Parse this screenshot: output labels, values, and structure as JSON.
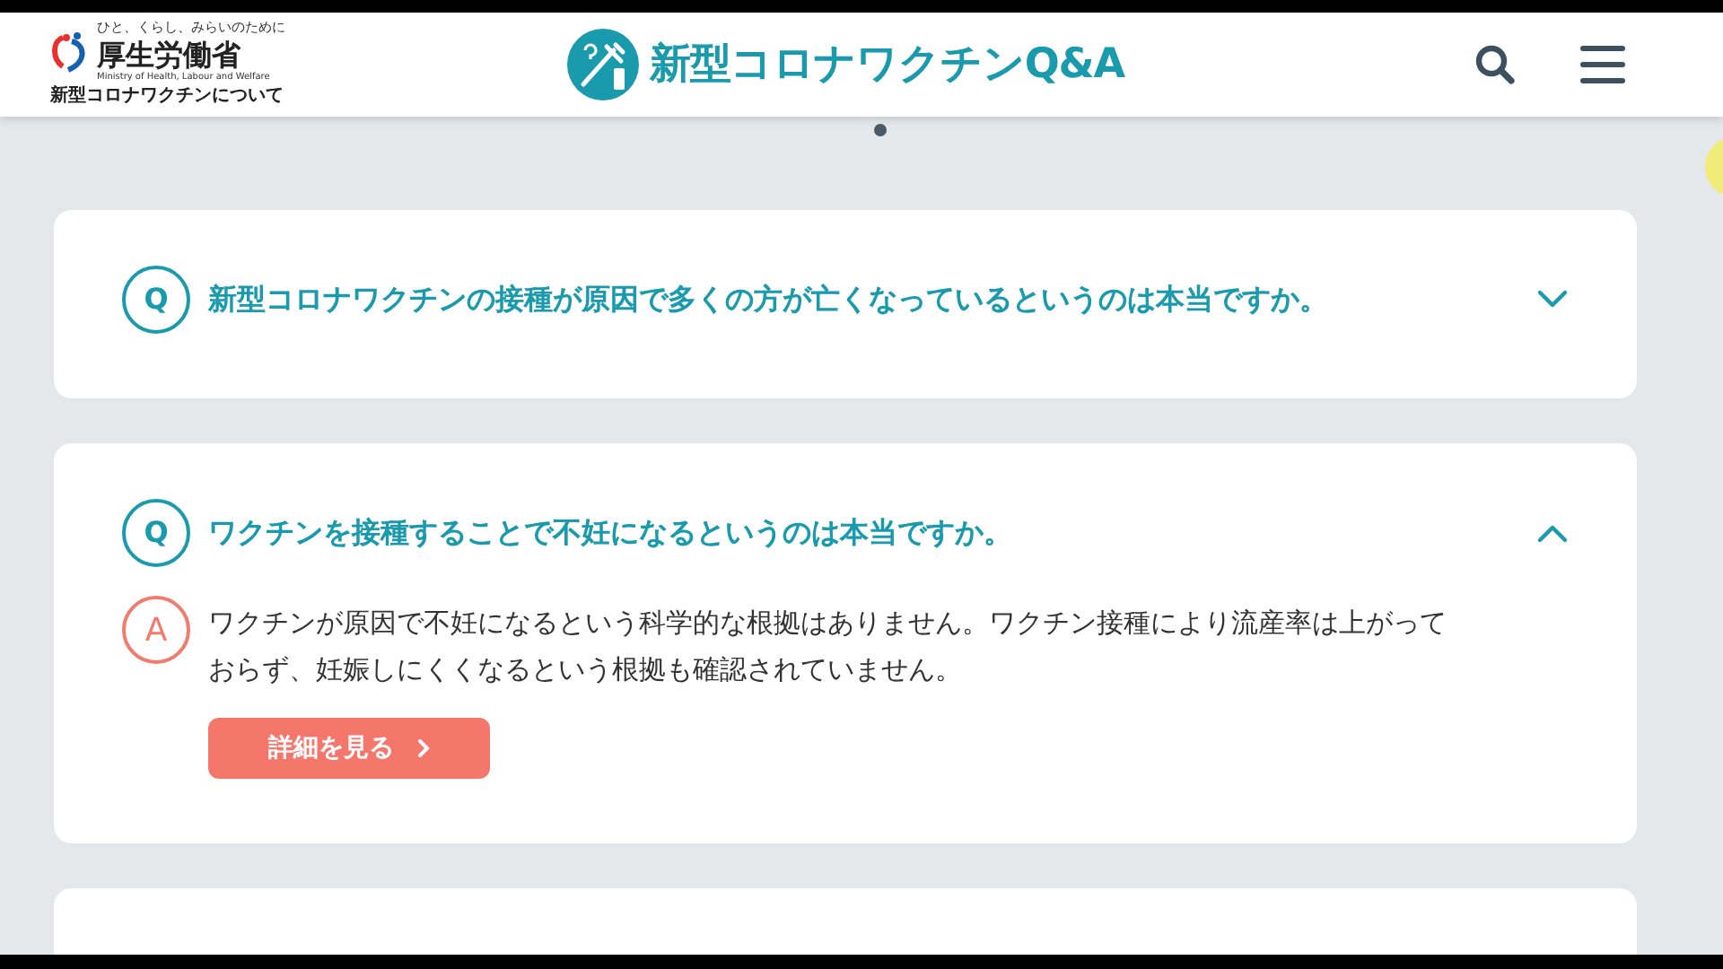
{
  "header": {
    "ministry": {
      "tagline": "ひと、くらし、みらいのために",
      "name": "厚生労働省",
      "english": "Ministry of Health, Labour and Welfare",
      "subtitle": "新型コロナワクチンについて"
    },
    "site_title": "新型コロナワクチンQ&A"
  },
  "faqs": [
    {
      "q_mark": "Q",
      "question": "新型コロナワクチンの接種が原因で多くの方が亡くなっているというのは本当ですか。",
      "expanded": false
    },
    {
      "q_mark": "Q",
      "question": "ワクチンを接種することで不妊になるというのは本当ですか。",
      "expanded": true,
      "a_mark": "A",
      "answer": "ワクチンが原因で不妊になるという科学的な根拠はありません。ワクチン接種により流産率は上がっておらず、妊娠しにくくなるという根拠も確認されていません。",
      "button": "詳細を見る"
    }
  ]
}
